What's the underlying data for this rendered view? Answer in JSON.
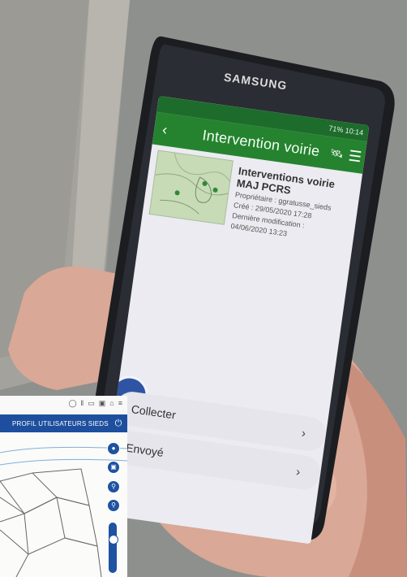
{
  "phone": {
    "brand": "SAMSUNG",
    "status": "71% 10:14"
  },
  "app": {
    "title": "Intervention voirie",
    "back_icon": "chevron-left-icon",
    "menu_icon": "hamburger-icon",
    "satellite_icon": "satellite-icon",
    "theme_color": "#25832f"
  },
  "survey": {
    "title": "Interventions voirie MAJ PCRS",
    "owner": "Propriétaire : ggratusse_sieds",
    "created": "Créé : 29/05/2020 17:28",
    "modified_label": "Dernière modification :",
    "modified": "04/06/2020 13:23"
  },
  "actions": [
    {
      "label": "Collecter"
    },
    {
      "label": "Envoyé"
    }
  ],
  "inset": {
    "header": "PROFIL UTILISATEURS SIEDS",
    "accent": "#1e4f9e"
  }
}
